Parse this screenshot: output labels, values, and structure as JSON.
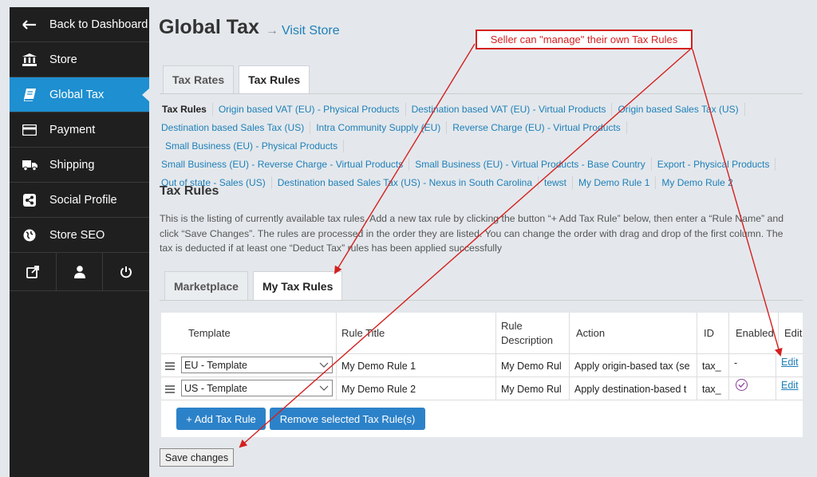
{
  "sidebar": {
    "items": [
      {
        "label": "Back to Dashboard",
        "icon": "arrow-left-icon"
      },
      {
        "label": "Store",
        "icon": "bank-icon"
      },
      {
        "label": "Global Tax",
        "icon": "book-icon",
        "active": true
      },
      {
        "label": "Payment",
        "icon": "credit-card-icon"
      },
      {
        "label": "Shipping",
        "icon": "truck-icon"
      },
      {
        "label": "Social Profile",
        "icon": "share-icon"
      },
      {
        "label": "Store SEO",
        "icon": "globe-icon"
      }
    ],
    "icon_row": [
      "external-link-icon",
      "user-icon",
      "power-icon"
    ]
  },
  "header": {
    "title": "Global Tax",
    "arrow": "→",
    "visit_store": "Visit Store"
  },
  "tabs_top": [
    "Tax Rates",
    "Tax Rules"
  ],
  "rule_links": [
    "Tax Rules",
    "Origin based VAT (EU) - Physical Products",
    "Destination based VAT (EU) - Virtual Products",
    "Origin based Sales Tax (US)",
    "Destination based Sales Tax (US)",
    "Intra Community Supply (EU)",
    "Reverse Charge (EU) - Virtual Products",
    "Small Business (EU) - Physical Products",
    "Small Business (EU) - Reverse Charge - Virtual Products",
    "Small Business (EU) - Virtual Products - Base Country",
    "Export - Physical Products",
    "Out of state - Sales (US)",
    "Destination based Sales Tax (US) - Nexus in South Carolina",
    "tewst",
    "My Demo Rule 1",
    "My Demo Rule 2"
  ],
  "section": {
    "title": "Tax Rules",
    "description": "This is the listing of currently available tax rules. Add a new tax rule by clicking the button “+ Add Tax Rule” below, then enter a “Rule Name” and click “Save Changes”. The rules are processed in the order they are listed. You can change the order with drag and drop of the first column. The tax is deducted if at least one “Deduct Tax” rules has been applied successfully"
  },
  "tabs_mid": [
    "Marketplace",
    "My Tax Rules"
  ],
  "table": {
    "headers": {
      "template": "Template",
      "title": "Rule Title",
      "description": "Rule Description",
      "action": "Action",
      "id": "ID",
      "enabled": "Enabled",
      "edit": "Edit"
    },
    "rows": [
      {
        "template": "EU - Template",
        "title": "My Demo Rule 1",
        "description": "My Demo Rul",
        "action": "Apply origin-based tax (se",
        "id": "tax_",
        "enabled": "-",
        "edit": "Edit"
      },
      {
        "template": "US - Template",
        "title": "My Demo Rule 2",
        "description": "My Demo Rul",
        "action": "Apply destination-based t",
        "id": "tax_",
        "enabled": "",
        "edit": "Edit"
      }
    ]
  },
  "buttons": {
    "add": "+ Add Tax Rule",
    "remove": "Remove selected Tax Rule(s)",
    "save": "Save changes"
  },
  "annotation": {
    "text": "Seller can \"manage\" their own Tax Rules",
    "color": "#d42020"
  },
  "colors": {
    "sidebar_bg": "#1f1f1f",
    "active": "#1e8fd0",
    "link": "#1e7fb8",
    "button": "#2c82c9"
  }
}
